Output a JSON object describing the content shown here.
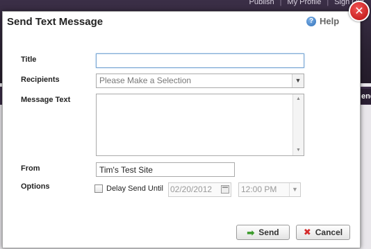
{
  "background": {
    "nav": [
      "Publish",
      "My Profile",
      "Sign Out"
    ],
    "side_tab": "end"
  },
  "dialog": {
    "title": "Send Text Message",
    "help_label": "Help",
    "help_icon": "question-circle-icon",
    "close_icon": "close-icon",
    "fields": {
      "title_label": "Title",
      "title_value": "",
      "recipients_label": "Recipients",
      "recipients_selected": "Please Make a Selection",
      "message_label": "Message Text",
      "message_value": "",
      "from_label": "From",
      "from_value": "Tim's Test Site",
      "options_label": "Options",
      "delay_label": "Delay Send Until",
      "delay_checked": false,
      "delay_date": "02/20/2012",
      "delay_time": "12:00 PM"
    },
    "buttons": {
      "send_label": "Send",
      "cancel_label": "Cancel"
    },
    "colors": {
      "close_red": "#c41a1a",
      "send_icon_green": "#3a9a2a",
      "cancel_icon_red": "#d42a2a"
    }
  }
}
